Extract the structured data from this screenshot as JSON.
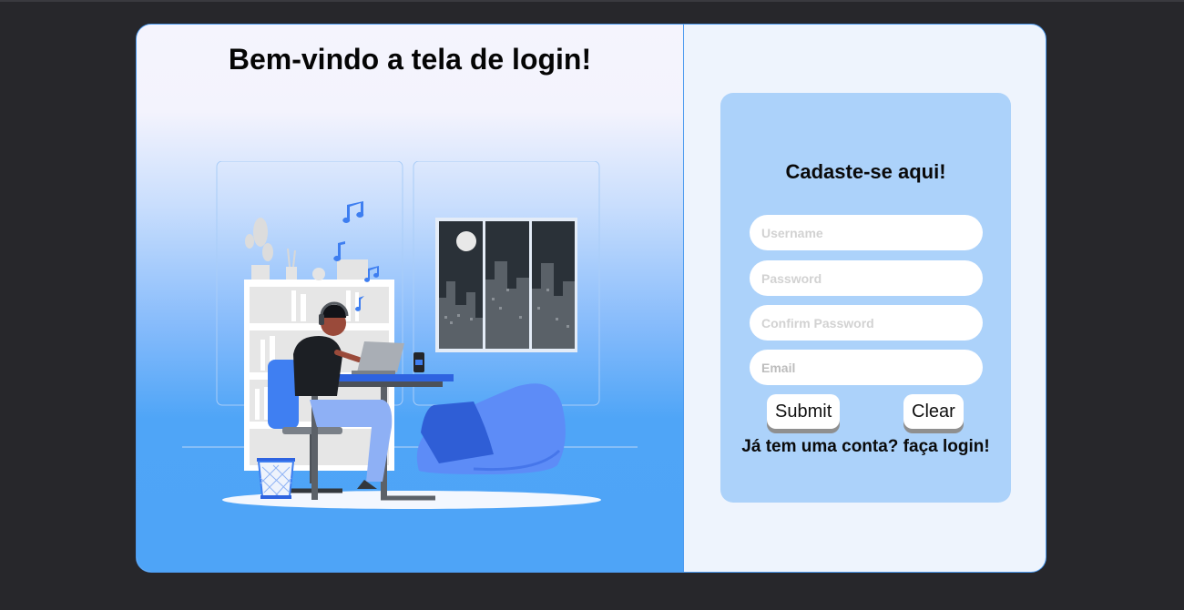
{
  "welcome": {
    "title": "Bem-vindo a tela de login!"
  },
  "signup": {
    "heading": "Cadaste-se aqui!",
    "fields": {
      "username": {
        "placeholder": "Username",
        "value": ""
      },
      "password": {
        "placeholder": "Password",
        "value": ""
      },
      "confirm_password": {
        "placeholder": "Confirm Password",
        "value": ""
      },
      "email": {
        "placeholder": "Email",
        "value": ""
      }
    },
    "submit_label": "Submit",
    "clear_label": "Clear",
    "login_link": "Já tem uma conta? faça login!"
  },
  "colors": {
    "page_bg": "#27272b",
    "card_border": "#4d9bf0",
    "form_bg": "#acd2fa",
    "panel_bg": "#eef4fd",
    "accent_blue": "#4ea4f7"
  },
  "illustration": {
    "subject": "person-working-at-desk-with-headphones",
    "icons": [
      "music-note-icon",
      "bookshelf",
      "city-window",
      "bean-bag",
      "waste-basket"
    ]
  }
}
